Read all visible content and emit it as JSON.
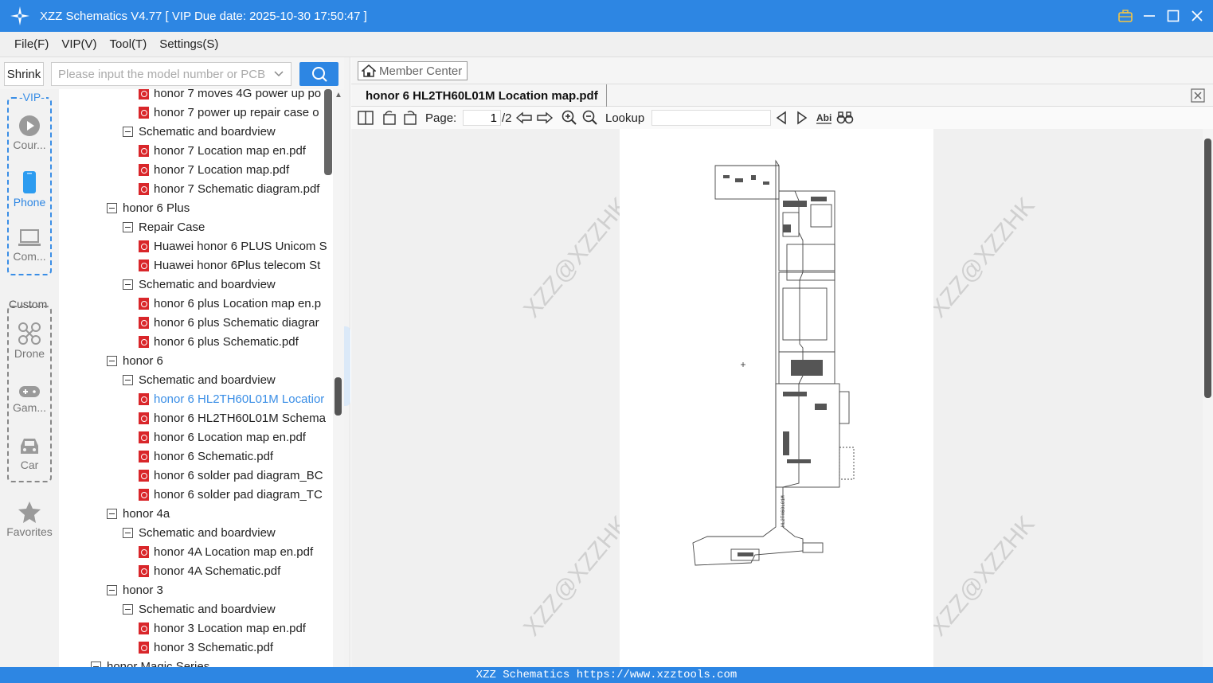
{
  "window": {
    "title": "XZZ Schematics V4.77 [ VIP Due date: 2025-10-30 17:50:47 ]"
  },
  "menu": [
    "File(F)",
    "VIP(V)",
    "Tool(T)",
    "Settings(S)"
  ],
  "search": {
    "shrink_label": "Shrink",
    "placeholder": "Please input the model number or PCB"
  },
  "sidebar": {
    "vip_label": "VIP",
    "custom_label": "Custom",
    "items": [
      {
        "label": "Cour...",
        "icon": "play-icon"
      },
      {
        "label": "Phone",
        "icon": "phone-icon"
      },
      {
        "label": "Com...",
        "icon": "laptop-icon"
      },
      {
        "label": "Drone",
        "icon": "drone-icon"
      },
      {
        "label": "Gam...",
        "icon": "gamepad-icon"
      },
      {
        "label": "Car",
        "icon": "car-icon"
      },
      {
        "label": "Favorites",
        "icon": "star-icon"
      }
    ]
  },
  "tree": [
    {
      "type": "pdf",
      "label": "honor 7 moves 4G power up po"
    },
    {
      "type": "pdf",
      "label": "honor 7 power up repair case o"
    },
    {
      "type": "folder",
      "label": "Schematic and boardview"
    },
    {
      "type": "pdf",
      "label": "honor 7 Location map en.pdf"
    },
    {
      "type": "pdf",
      "label": "honor 7 Location map.pdf"
    },
    {
      "type": "pdf",
      "label": "honor 7 Schematic diagram.pdf"
    },
    {
      "type": "model",
      "label": "honor 6 Plus"
    },
    {
      "type": "folder",
      "label": "Repair Case"
    },
    {
      "type": "pdf",
      "label": "Huawei honor 6 PLUS Unicom S"
    },
    {
      "type": "pdf",
      "label": "Huawei honor 6Plus telecom St"
    },
    {
      "type": "folder",
      "label": "Schematic and boardview"
    },
    {
      "type": "pdf",
      "label": "honor 6 plus Location map en.p"
    },
    {
      "type": "pdf",
      "label": "honor 6 plus Schematic diagrar"
    },
    {
      "type": "pdf",
      "label": "honor 6 plus Schematic.pdf"
    },
    {
      "type": "model",
      "label": "honor 6"
    },
    {
      "type": "folder",
      "label": "Schematic and boardview"
    },
    {
      "type": "pdf",
      "label": "honor 6 HL2TH60L01M Locatior",
      "selected": true
    },
    {
      "type": "pdf",
      "label": "honor 6 HL2TH60L01M Schema"
    },
    {
      "type": "pdf",
      "label": "honor 6 Location map en.pdf"
    },
    {
      "type": "pdf",
      "label": "honor 6 Schematic.pdf"
    },
    {
      "type": "pdf",
      "label": "honor 6 solder pad diagram_BC"
    },
    {
      "type": "pdf",
      "label": "honor 6 solder pad diagram_TC"
    },
    {
      "type": "model",
      "label": "honor 4a"
    },
    {
      "type": "folder",
      "label": "Schematic and boardview"
    },
    {
      "type": "pdf",
      "label": "honor 4A Location map en.pdf"
    },
    {
      "type": "pdf",
      "label": "honor 4A Schematic.pdf"
    },
    {
      "type": "model",
      "label": "honor 3"
    },
    {
      "type": "folder",
      "label": "Schematic and boardview"
    },
    {
      "type": "pdf",
      "label": "honor 3 Location map en.pdf"
    },
    {
      "type": "pdf",
      "label": "honor 3 Schematic.pdf"
    },
    {
      "type": "series",
      "label": "honor Magic Series"
    }
  ],
  "viewer": {
    "member_center": "Member Center",
    "tab_title": "honor 6 HL2TH60L01M Location map.pdf",
    "page_label": "Page:",
    "page_value": "1",
    "page_total": "/2",
    "lookup_label": "Lookup",
    "lookup_value": "",
    "watermark": "XZZ@XZZHK",
    "board_label": "HL2TH60L01M"
  },
  "status": {
    "text": "XZZ Schematics https://www.xzztools.com"
  },
  "colors": {
    "accent": "#2d86e3",
    "selected": "#3a8ee6",
    "pdf_icon": "#d9262a"
  }
}
